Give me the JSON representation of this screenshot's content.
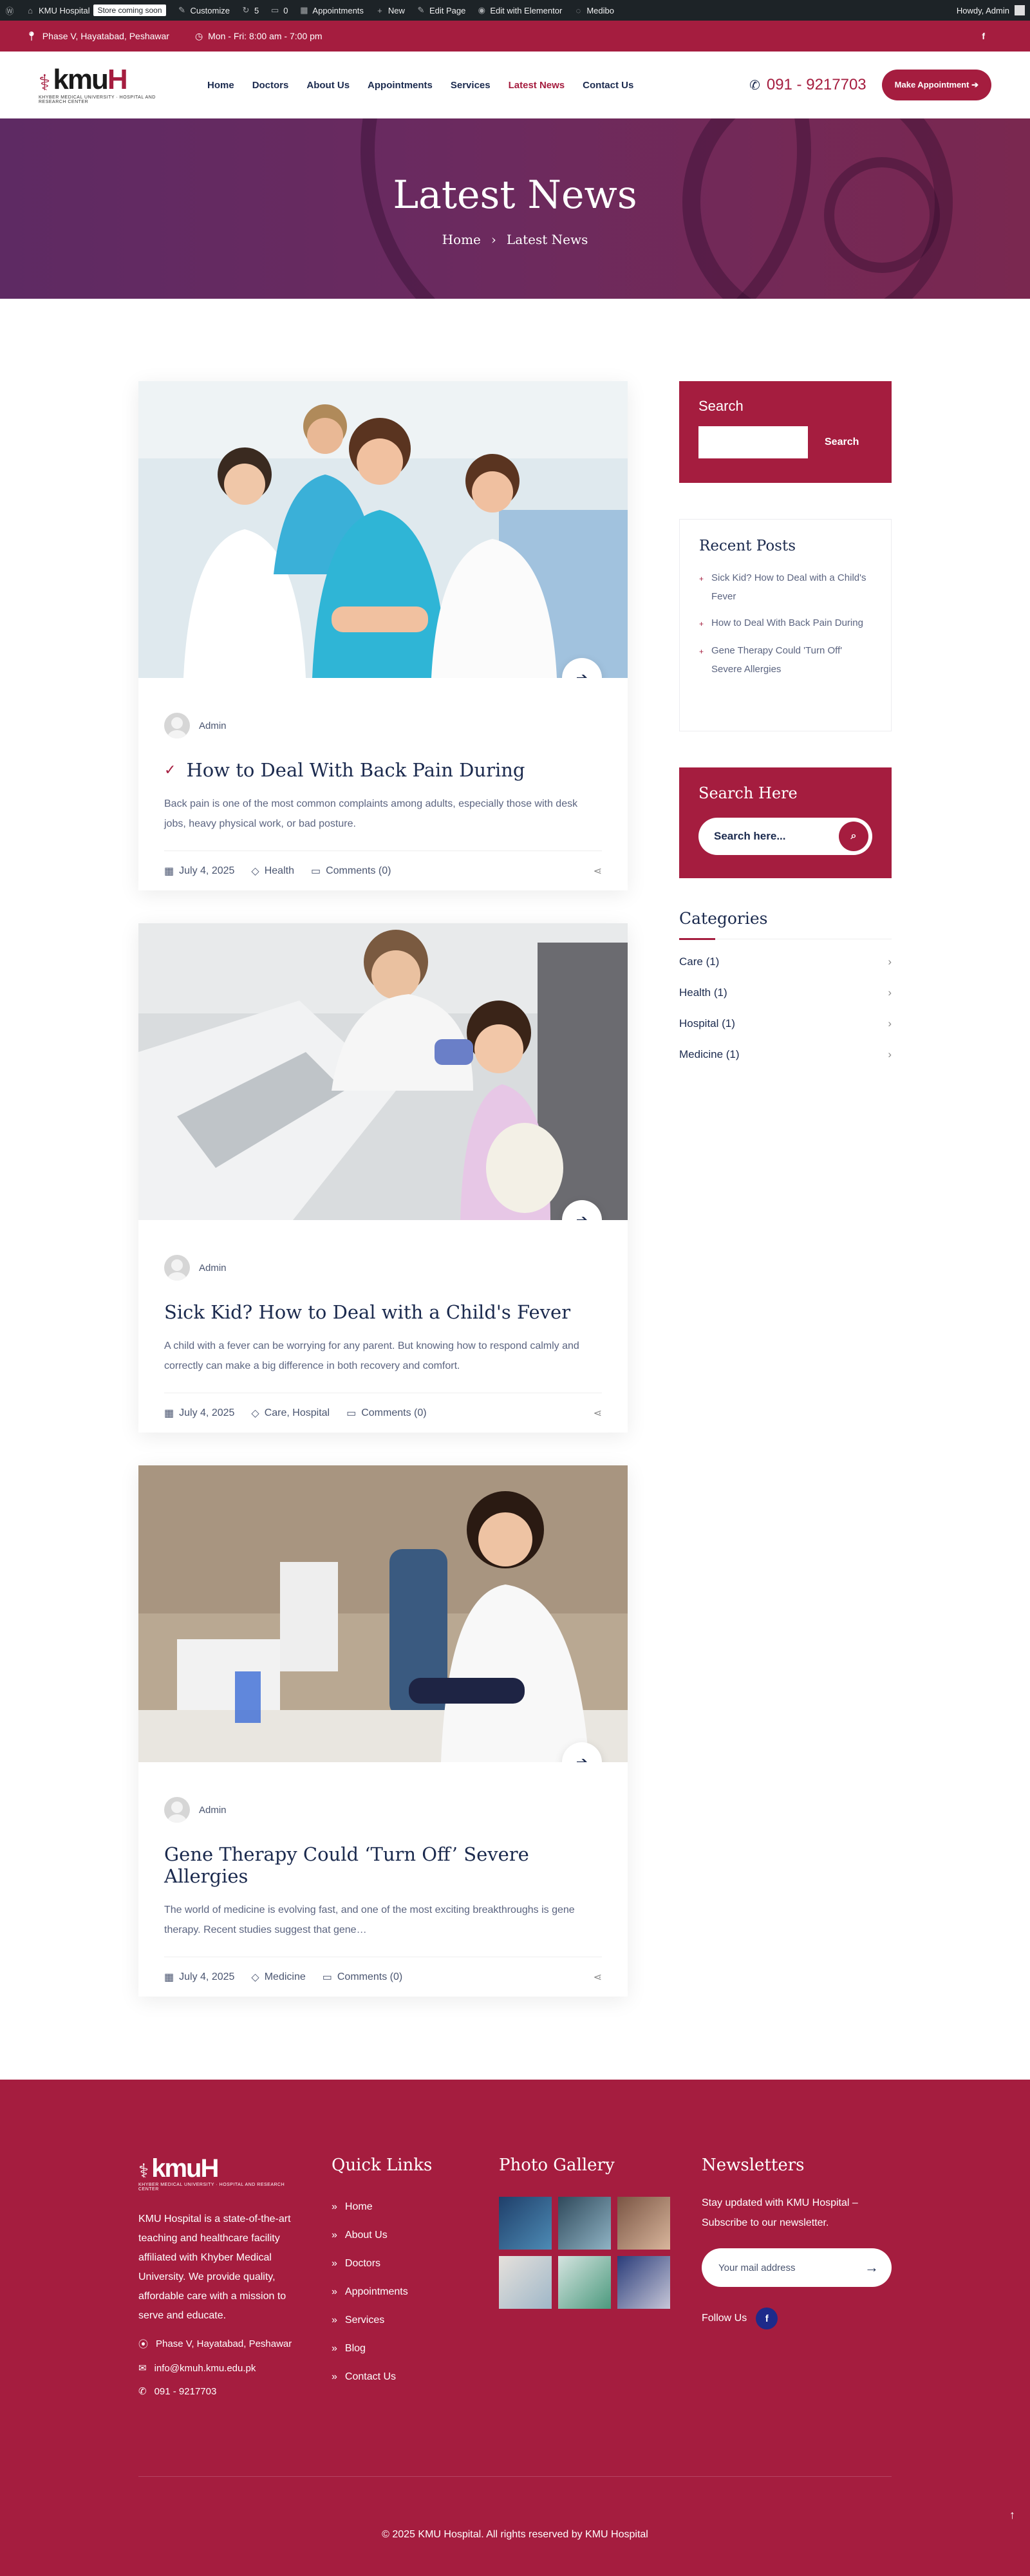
{
  "admin_bar": {
    "site_name": "KMU Hospital",
    "store_badge": "Store coming soon",
    "customize": "Customize",
    "updates_count": "5",
    "comments_count": "0",
    "appointments": "Appointments",
    "new": "New",
    "edit_page": "Edit Page",
    "edit_elementor": "Edit with Elementor",
    "medibo": "Medibo",
    "howdy": "Howdy, Admin"
  },
  "topbar": {
    "address": "Phase V, Hayatabad, Peshawar",
    "hours": "Mon - Fri: 8:00 am - 7:00 pm"
  },
  "header": {
    "logo_word_a": "kmu",
    "logo_word_b": "H",
    "logo_sub": "KHYBER MEDICAL UNIVERSITY · HOSPITAL AND RESEARCH CENTER",
    "nav": [
      "Home",
      "Doctors",
      "About Us",
      "Appointments",
      "Services",
      "Latest News",
      "Contact Us"
    ],
    "active_nav": "Latest News",
    "phone": "091 - 9217703",
    "cta": "Make Appointment"
  },
  "hero": {
    "title": "Latest News",
    "crumb_home": "Home",
    "crumb_current": "Latest News"
  },
  "posts": [
    {
      "author": "Admin",
      "title": "How to Deal With Back Pain During",
      "excerpt": "Back pain is one of the most common complaints among adults, especially those with desk jobs, heavy physical work, or bad posture.",
      "date": "July 4, 2025",
      "category": "Health",
      "comments": "Comments (0)"
    },
    {
      "author": "Admin",
      "title": "Sick Kid? How to Deal with a Child's Fever",
      "excerpt": "A child with a fever can be worrying for any parent. But knowing how to respond calmly and correctly can make a big difference in both recovery and comfort.",
      "date": "July 4, 2025",
      "category": "Care, Hospital",
      "comments": "Comments (0)"
    },
    {
      "author": "Admin",
      "title": "Gene Therapy Could ‘Turn Off’ Severe Allergies",
      "excerpt": "The world of medicine is evolving fast, and one of the most exciting breakthroughs is gene therapy. Recent studies suggest that gene…",
      "date": "July 4, 2025",
      "category": "Medicine",
      "comments": "Comments (0)"
    }
  ],
  "sidebar": {
    "search_title": "Search",
    "search_button": "Search",
    "recent_title": "Recent Posts",
    "recent": [
      "Sick Kid? How to Deal with a Child's Fever",
      "How to Deal With Back Pain During",
      "Gene Therapy Could 'Turn Off' Severe Allergies"
    ],
    "search_here_title": "Search Here",
    "search_here_placeholder": "Search here...",
    "categories_title": "Categories",
    "categories": [
      "Care (1)",
      "Health (1)",
      "Hospital (1)",
      "Medicine (1)"
    ]
  },
  "footer": {
    "about": "KMU Hospital is a state-of-the-art teaching and healthcare facility affiliated with Khyber Medical University. We provide quality, affordable care with a mission to serve and educate.",
    "address": "Phase V, Hayatabad, Peshawar",
    "email": "info@kmuh.kmu.edu.pk",
    "phone": "091 - 9217703",
    "quick_links_title": "Quick Links",
    "quick_links": [
      "Home",
      "About Us",
      "Doctors",
      "Appointments",
      "Services",
      "Blog",
      "Contact Us"
    ],
    "gallery_title": "Photo Gallery",
    "newsletter_title": "Newsletters",
    "newsletter_text": "Stay updated with KMU Hospital – Subscribe to our newsletter.",
    "newsletter_placeholder": "Your mail address",
    "follow": "Follow Us",
    "copyright": "© 2025 KMU Hospital. All rights reserved by KMU Hospital"
  },
  "colors": {
    "brand": "#a51d3f",
    "navy": "#1b2a4e",
    "admin_bar": "#1d2327"
  }
}
